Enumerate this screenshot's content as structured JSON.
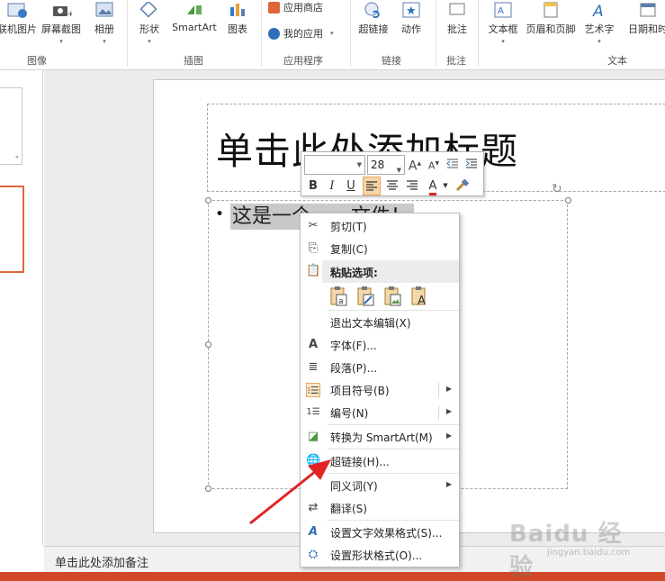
{
  "ribbon": {
    "groups": [
      {
        "label": "图像"
      },
      {
        "label": "插图"
      },
      {
        "label": "应用程序"
      },
      {
        "label": "链接"
      },
      {
        "label": "批注"
      },
      {
        "label": "文本"
      }
    ],
    "buttons": {
      "online_pictures": "联机图片",
      "screenshot": "屏幕截图",
      "album": "相册",
      "shapes": "形状",
      "smartart": "SmartArt",
      "chart": "图表",
      "app_store": "应用商店",
      "my_apps": "我的应用",
      "hyperlink": "超链接",
      "action": "动作",
      "comment": "批注",
      "textbox": "文本框",
      "header_footer": "页眉和页脚",
      "wordart": "艺术字",
      "datetime": "日期和时"
    }
  },
  "slide": {
    "title": "单击此处添加标题",
    "body_bullet": "•",
    "body_text": "这是一个一一文件！"
  },
  "notes": {
    "placeholder": "单击此处添加备注"
  },
  "mini_toolbar": {
    "font_name": "",
    "font_size": "28",
    "grow_label": "A",
    "shrink_label": "A",
    "bold": "B",
    "italic": "I",
    "underline": "U",
    "font_color": "A"
  },
  "context_menu": {
    "items": [
      {
        "label": "剪切(T)"
      },
      {
        "label": "复制(C)"
      },
      {
        "label": "粘贴选项:"
      },
      {
        "label": "退出文本编辑(X)"
      },
      {
        "label": "字体(F)..."
      },
      {
        "label": "段落(P)..."
      },
      {
        "label": "项目符号(B)"
      },
      {
        "label": "编号(N)"
      },
      {
        "label": "转换为 SmartArt(M)"
      },
      {
        "label": "超链接(H)..."
      },
      {
        "label": "同义词(Y)"
      },
      {
        "label": "翻译(S)"
      },
      {
        "label": "设置文字效果格式(S)..."
      },
      {
        "label": "设置形状格式(O)..."
      }
    ]
  },
  "watermark": {
    "brand": "Baidu 经验",
    "url": "jingyan.baidu.com"
  },
  "colors": {
    "accent_orange": "#e0663a",
    "status_bar": "#d24726",
    "arrow_red": "#e02424",
    "hover_highlight": "#f6d4a6"
  }
}
